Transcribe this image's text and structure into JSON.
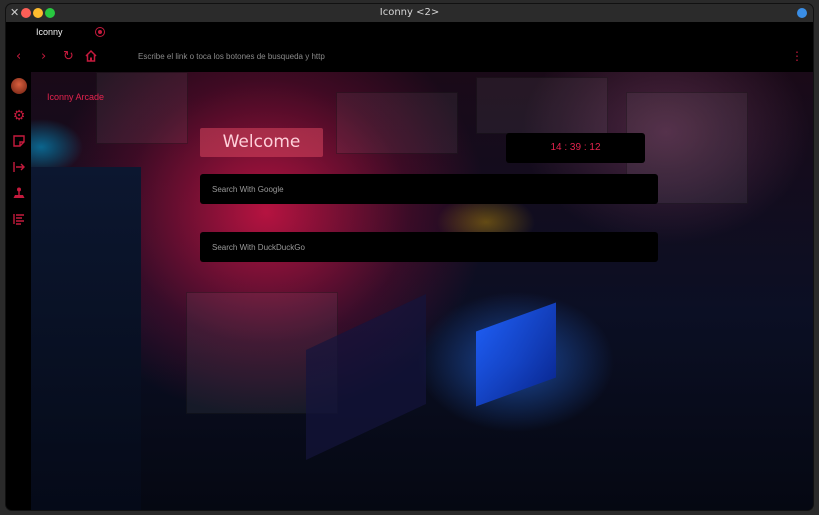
{
  "window": {
    "title": "Iconny <2>"
  },
  "colors": {
    "accent": "#c51a3d",
    "close_dot": "#ff5f57",
    "minimize_dot": "#febc2e",
    "maximize_dot": "#28c840",
    "status_dot": "#3a8ee6"
  },
  "tabs": [
    {
      "label": "Iconny"
    }
  ],
  "nav": {
    "back_icon": "chevron-left-icon",
    "forward_icon": "chevron-right-icon",
    "reload_icon": "reload-icon",
    "home_icon": "home-icon",
    "address_placeholder": "Escribe el link o toca los botones de busqueda y http",
    "menu_icon": "vertical-dots-icon"
  },
  "sidebar": {
    "items": [
      {
        "icon": "avatar"
      },
      {
        "icon": "gear-icon"
      },
      {
        "icon": "note-icon"
      },
      {
        "icon": "logout-icon"
      },
      {
        "icon": "joystick-icon"
      },
      {
        "icon": "list-icon"
      }
    ]
  },
  "main": {
    "brand": "Iconny Arcade",
    "welcome": "Welcome",
    "clock": "14 : 39 : 12",
    "search_google_placeholder": "Search With Google",
    "search_duck_placeholder": "Search With DuckDuckGo"
  }
}
